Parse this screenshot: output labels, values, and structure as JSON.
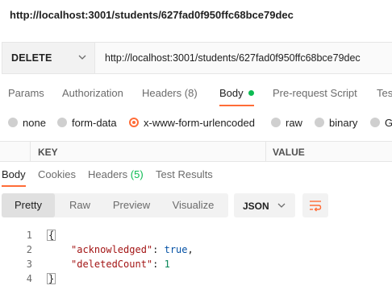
{
  "title": {
    "url": "http://localhost:3001/students/627fad0f950ffc68bce79dec"
  },
  "request": {
    "method": "DELETE",
    "url": "http://localhost:3001/students/627fad0f950ffc68bce79dec"
  },
  "request_tabs": [
    {
      "label": "Params"
    },
    {
      "label": "Authorization"
    },
    {
      "label": "Headers",
      "count": "(8)"
    },
    {
      "label": "Body"
    },
    {
      "label": "Pre-request Script"
    },
    {
      "label": "Tes"
    }
  ],
  "body_modes": [
    {
      "label": "none"
    },
    {
      "label": "form-data"
    },
    {
      "label": "x-www-form-urlencoded"
    },
    {
      "label": "raw"
    },
    {
      "label": "binary"
    },
    {
      "label": "G"
    }
  ],
  "kv_table": {
    "key_header": "KEY",
    "value_header": "VALUE"
  },
  "response_tabs": [
    {
      "label": "Body"
    },
    {
      "label": "Cookies"
    },
    {
      "label": "Headers",
      "count": "(5)"
    },
    {
      "label": "Test Results"
    }
  ],
  "view_modes": [
    "Pretty",
    "Raw",
    "Preview",
    "Visualize"
  ],
  "format": "JSON",
  "code_lines": [
    {
      "num": "1",
      "text": "{"
    },
    {
      "num": "2",
      "key": "\"acknowledged\"",
      "value": "true"
    },
    {
      "num": "3",
      "key": "\"deletedCount\"",
      "value": "1"
    },
    {
      "num": "4",
      "text": "}"
    }
  ],
  "colors": {
    "accent": "#ff6c37",
    "success": "#0cbb52"
  }
}
